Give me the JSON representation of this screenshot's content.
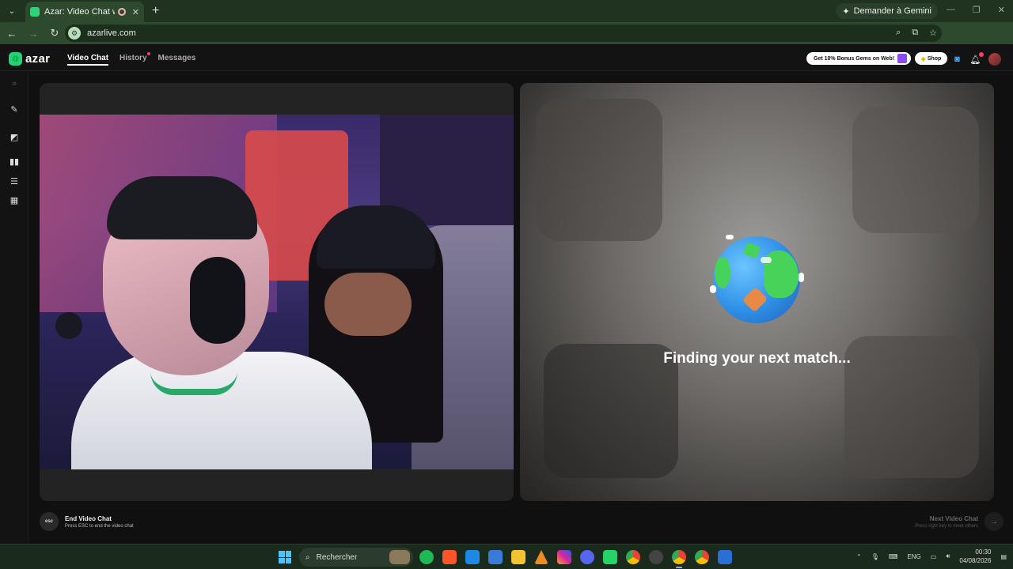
{
  "browser": {
    "tab_title": "Azar: Video Chat with New",
    "new_tab": "+",
    "gemini_label": "Demander à Gemini",
    "url": "azarlive.com"
  },
  "app": {
    "logo_text": "azar",
    "nav": {
      "video_chat": "Video Chat",
      "history": "History",
      "messages": "Messages"
    },
    "promo": "Get 10% Bonus Gems on Web!",
    "shop": "Shop"
  },
  "main": {
    "finding_text": "Finding your next match...",
    "end_chat": {
      "key": "esc",
      "title": "End Video Chat",
      "subtitle": "Press ESC to end the video chat"
    },
    "next_chat": {
      "title": "Next Video Chat",
      "subtitle": "Press right key to meet others",
      "arrow": "→"
    }
  },
  "taskbar": {
    "search_placeholder": "Rechercher",
    "language": "ENG",
    "time": "00:30",
    "date": "04/08/2026"
  },
  "colors": {
    "brand_green": "#27d07a",
    "notification": "#ff3b6b",
    "chrome_green": "#2d4a2e"
  }
}
